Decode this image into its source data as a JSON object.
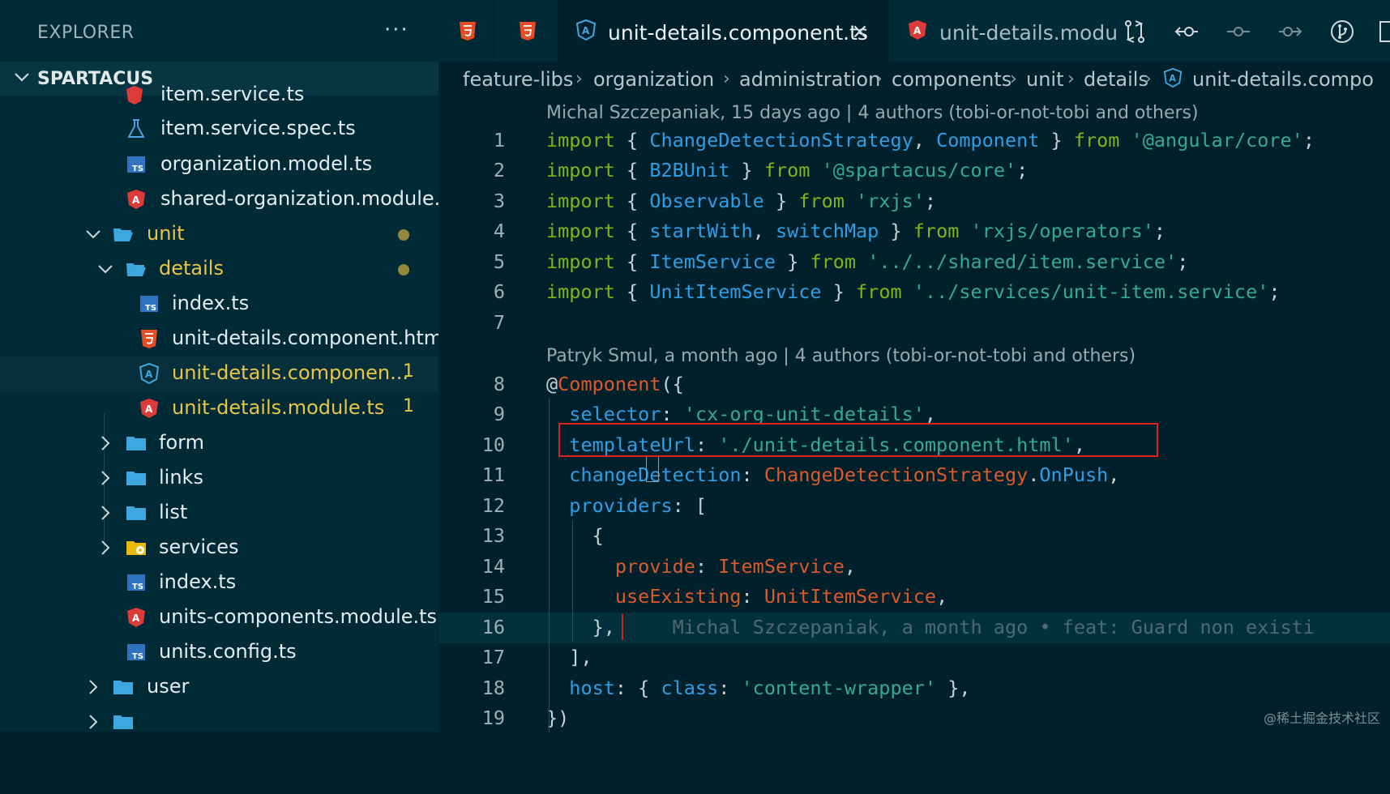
{
  "sidebar": {
    "title": "EXPLORER",
    "more": "···",
    "section": "SPARTACUS",
    "items": [
      {
        "label": "item.service.ts",
        "icon": "angular-service-icon"
      },
      {
        "label": "item.service.spec.ts",
        "icon": "test-flask-icon"
      },
      {
        "label": "organization.model.ts",
        "icon": "typescript-icon"
      },
      {
        "label": "shared-organization.module...",
        "icon": "angular-module-icon"
      },
      {
        "label": "unit",
        "icon": "folder-open-icon"
      },
      {
        "label": "details",
        "icon": "folder-open-icon"
      },
      {
        "label": "index.ts",
        "icon": "typescript-icon"
      },
      {
        "label": "unit-details.component.html",
        "icon": "html-icon"
      },
      {
        "label": "unit-details.componen...",
        "icon": "angular-component-icon",
        "badge": "1"
      },
      {
        "label": "unit-details.module.ts",
        "icon": "angular-module-icon",
        "badge": "1"
      },
      {
        "label": "form",
        "icon": "folder-icon"
      },
      {
        "label": "links",
        "icon": "folder-icon"
      },
      {
        "label": "list",
        "icon": "folder-icon"
      },
      {
        "label": "services",
        "icon": "services-folder-icon"
      },
      {
        "label": "index.ts",
        "icon": "typescript-icon"
      },
      {
        "label": "units-components.module.ts",
        "icon": "angular-module-icon"
      },
      {
        "label": "units.config.ts",
        "icon": "typescript-icon"
      },
      {
        "label": "user",
        "icon": "folder-icon"
      }
    ]
  },
  "tabs": [
    {
      "label": "",
      "icon": "html-icon"
    },
    {
      "label": "",
      "icon": "html-icon"
    },
    {
      "label": "unit-details.component.ts",
      "icon": "angular-component-icon",
      "close": "×"
    },
    {
      "label": "unit-details.modu",
      "icon": "angular-module-icon"
    }
  ],
  "breadcrumb": [
    "feature-libs",
    "organization",
    "administration",
    "components",
    "unit",
    "details",
    "unit-details.compo"
  ],
  "codelens": [
    "Michal Szczepaniak, 15 days ago | 4 authors (tobi-or-not-tobi and others)",
    "Patryk Smul, a month ago | 4 authors (tobi-or-not-tobi and others)"
  ],
  "lines": {
    "1": "1",
    "2": "2",
    "3": "3",
    "4": "4",
    "5": "5",
    "6": "6",
    "7": "7",
    "8": "8",
    "9": "9",
    "10": "10",
    "11": "11",
    "12": "12",
    "13": "13",
    "14": "14",
    "15": "15",
    "16": "16",
    "17": "17",
    "18": "18",
    "19": "19"
  },
  "code": {
    "import": "import",
    "from": "from",
    "l1a": "ChangeDetectionStrategy",
    "l1b": "Component",
    "l1s": "'@angular/core'",
    "l2a": "B2BUnit",
    "l2s": "'@spartacus/core'",
    "l3a": "Observable",
    "l3s": "'rxjs'",
    "l4a": "startWith",
    "l4b": "switchMap",
    "l4s": "'rxjs/operators'",
    "l5a": "ItemService",
    "l5s": "'../../shared/item.service'",
    "l6a": "UnitItemService",
    "l6s": "'../services/unit-item.service'",
    "l8": "Component",
    "l9k": "selector",
    "l9s": "'cx-org-unit-details'",
    "l10k": "templateUrl",
    "l10s": "'./unit-details.component.html'",
    "l11k": "changeDetection",
    "l11a": "ChangeDetectionStrategy",
    "l11b": "OnPush",
    "l12k": "providers",
    "l14k": "provide",
    "l14v": "ItemService",
    "l15k": "useExisting",
    "l15v": "UnitItemService",
    "l16blame": "Michal Szczepaniak, a month ago • feat: Guard non existi",
    "l18k": "host",
    "l18p": "class",
    "l18s": "'content-wrapper'"
  },
  "watermark": "@稀土掘金技术社区"
}
